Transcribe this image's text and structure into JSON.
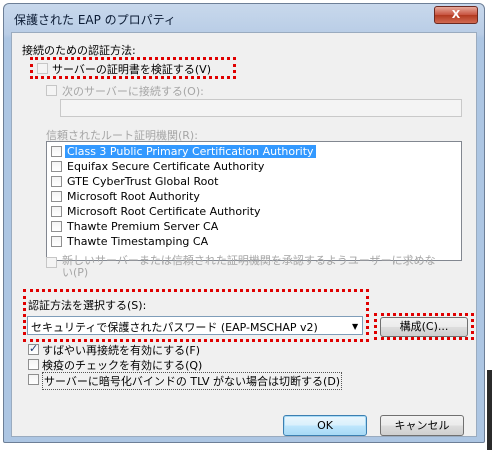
{
  "window": {
    "title": "保護された EAP のプロパティ",
    "close_label": "X"
  },
  "auth": {
    "section_label": "接続のための認証方法:",
    "validate_cert_label": "サーバーの証明書を検証する(V)",
    "connect_servers_label": "次のサーバーに接続する(O):",
    "connect_servers_value": "",
    "root_ca_label": "信頼されたルート証明機関(R):",
    "root_ca_items": [
      {
        "label": "Class 3 Public Primary Certification Authority",
        "checked": false,
        "selected": true
      },
      {
        "label": "Equifax Secure Certificate Authority",
        "checked": false,
        "selected": false
      },
      {
        "label": "GTE CyberTrust Global Root",
        "checked": false,
        "selected": false
      },
      {
        "label": "Microsoft Root Authority",
        "checked": false,
        "selected": false
      },
      {
        "label": "Microsoft Root Certificate Authority",
        "checked": false,
        "selected": false
      },
      {
        "label": "Thawte Premium Server CA",
        "checked": false,
        "selected": false
      },
      {
        "label": "Thawte Timestamping CA",
        "checked": false,
        "selected": false
      }
    ],
    "prompt_label_line1": "新しいサーバーまたは信頼された証明機関を承認するようユーザーに求めな",
    "prompt_label_line2": "い(P)"
  },
  "method": {
    "select_label": "認証方法を選択する(S):",
    "selected_value": "セキュリティで保護されたパスワード (EAP-MSCHAP v2)",
    "configure_label": "構成(C)..."
  },
  "options": {
    "fast_reconnect_label": "すばやい再接続を有効にする(F)",
    "fast_reconnect_checked": true,
    "quarantine_label": "検疫のチェックを有効にする(Q)",
    "quarantine_checked": false,
    "disconnect_label": "サーバーに暗号化バインドの TLV がない場合は切断する(D)",
    "disconnect_checked": false
  },
  "footer": {
    "ok_label": "OK",
    "cancel_label": "キャンセル"
  },
  "colors": {
    "highlight": "#e00000",
    "selection": "#3399ff"
  }
}
